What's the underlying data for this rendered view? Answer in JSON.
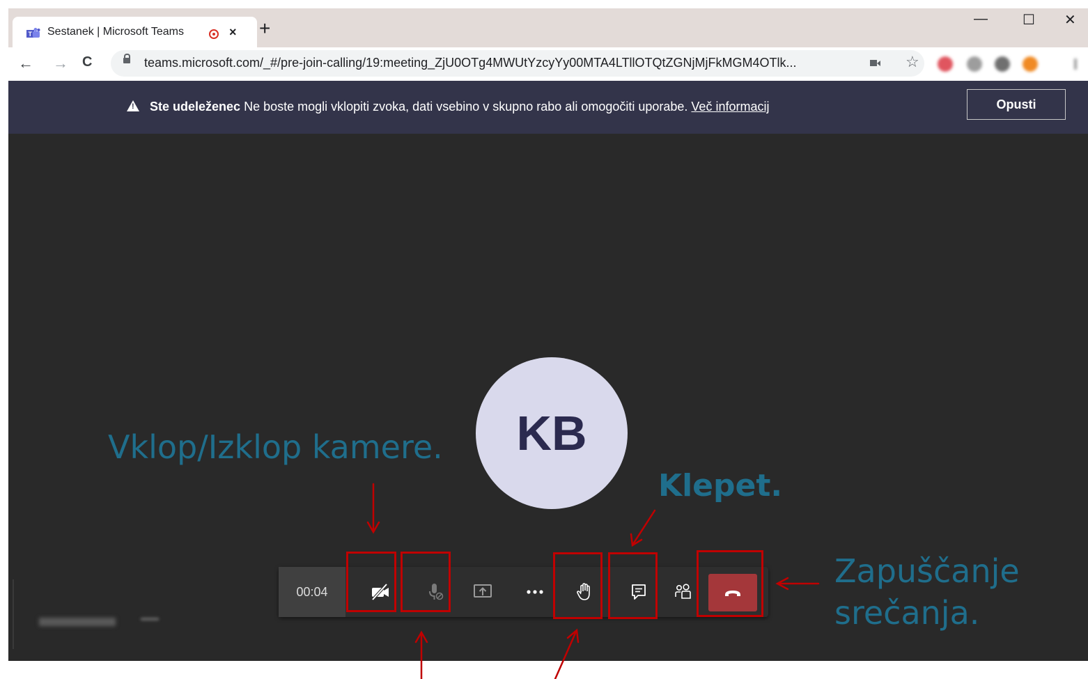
{
  "browser": {
    "tab_title": "Sestanek | Microsoft Teams",
    "tab_close": "×",
    "new_tab": "+",
    "url": "teams.microsoft.com/_#/pre-join-calling/19:meeting_ZjU0OTg4MWUtYzcyYy00MTA4LTllOTQtZGNjMjFkMGM4OTlk...",
    "window_controls": {
      "minimize": "—",
      "maximize": "☐",
      "close": "✕"
    },
    "nav": {
      "back": "←",
      "forward": "→",
      "reload": "C"
    },
    "star": "☆"
  },
  "banner": {
    "bold": "Ste udeleženec",
    "message": " Ne boste mogli vklopiti zvoka, dati vsebino v skupno rabo ali omogočiti uporabe. ",
    "link": "Več informacij",
    "dismiss": "Opusti"
  },
  "meeting": {
    "avatar_initials": "KB",
    "timer": "00:04",
    "hangup_color": "#a4373a"
  },
  "annotations": {
    "camera": "Vklop/Izklop kamere.",
    "chat": "Klepet.",
    "leave_line1": "Zapuščanje",
    "leave_line2": "srečanja.",
    "text_color": "#1f6e8c",
    "highlight_color": "#c00000"
  },
  "icons": [
    "teams-favicon",
    "record-indicator-icon",
    "lock-icon",
    "camera-icon",
    "star-icon",
    "camera-off-icon",
    "mic-off-icon",
    "share-screen-icon",
    "more-icon",
    "raise-hand-icon",
    "chat-icon",
    "participants-icon",
    "hang-up-icon"
  ]
}
